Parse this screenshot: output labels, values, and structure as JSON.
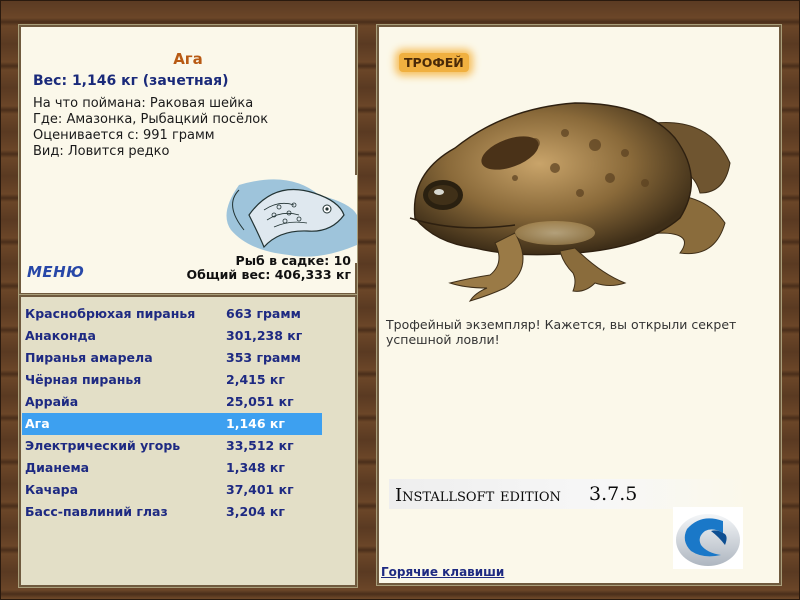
{
  "fish": {
    "name": "Ага",
    "weight_line": "Вес: 1,146 кг (зачетная)",
    "details": [
      {
        "key": "На что поймана:",
        "value": "Раковая шейка"
      },
      {
        "key": "Где:",
        "value": "Амазонка, Рыбацкий посёлок"
      },
      {
        "key": "Оценивается с:",
        "value": "991 грамм"
      },
      {
        "key": "Вид:",
        "value": "Ловится редко"
      }
    ]
  },
  "menu_label": "МЕНЮ",
  "cage": {
    "count_text": "Рыб в садке: 10",
    "total_text": "Общий вес: 406,333 кг"
  },
  "catch_list": [
    {
      "name": "Краснобрюхая пиранья",
      "weight": "663 грамм"
    },
    {
      "name": "Анаконда",
      "weight": "301,238 кг"
    },
    {
      "name": "Пиранья амарела",
      "weight": "353 грамм"
    },
    {
      "name": "Чёрная пиранья",
      "weight": "2,415 кг"
    },
    {
      "name": "Аррайа",
      "weight": "25,051 кг"
    },
    {
      "name": "Ага",
      "weight": "1,146 кг"
    },
    {
      "name": "Электрический угорь",
      "weight": "33,512 кг"
    },
    {
      "name": "Дианема",
      "weight": "1,348 кг"
    },
    {
      "name": "Качара",
      "weight": "37,401 кг"
    },
    {
      "name": "Басс-павлиний глаз",
      "weight": "3,204 кг"
    }
  ],
  "selected_index": 5,
  "trophy": {
    "badge": "ТРОФЕЙ",
    "text": "Трофейный экземпляр! Кажется, вы открыли секрет успешной ловли!"
  },
  "edition": {
    "name": "Installsoft edition",
    "version": "3.7.5"
  },
  "hotkeys_label": "Горячие клавиши",
  "colors": {
    "selection": "#3da0f0",
    "list_text": "#1e2a82",
    "title": "#b85a14",
    "trophy_badge": "#f0b040"
  },
  "icons": [
    "fish-drawing",
    "toad-image",
    "installsoft-logo"
  ]
}
